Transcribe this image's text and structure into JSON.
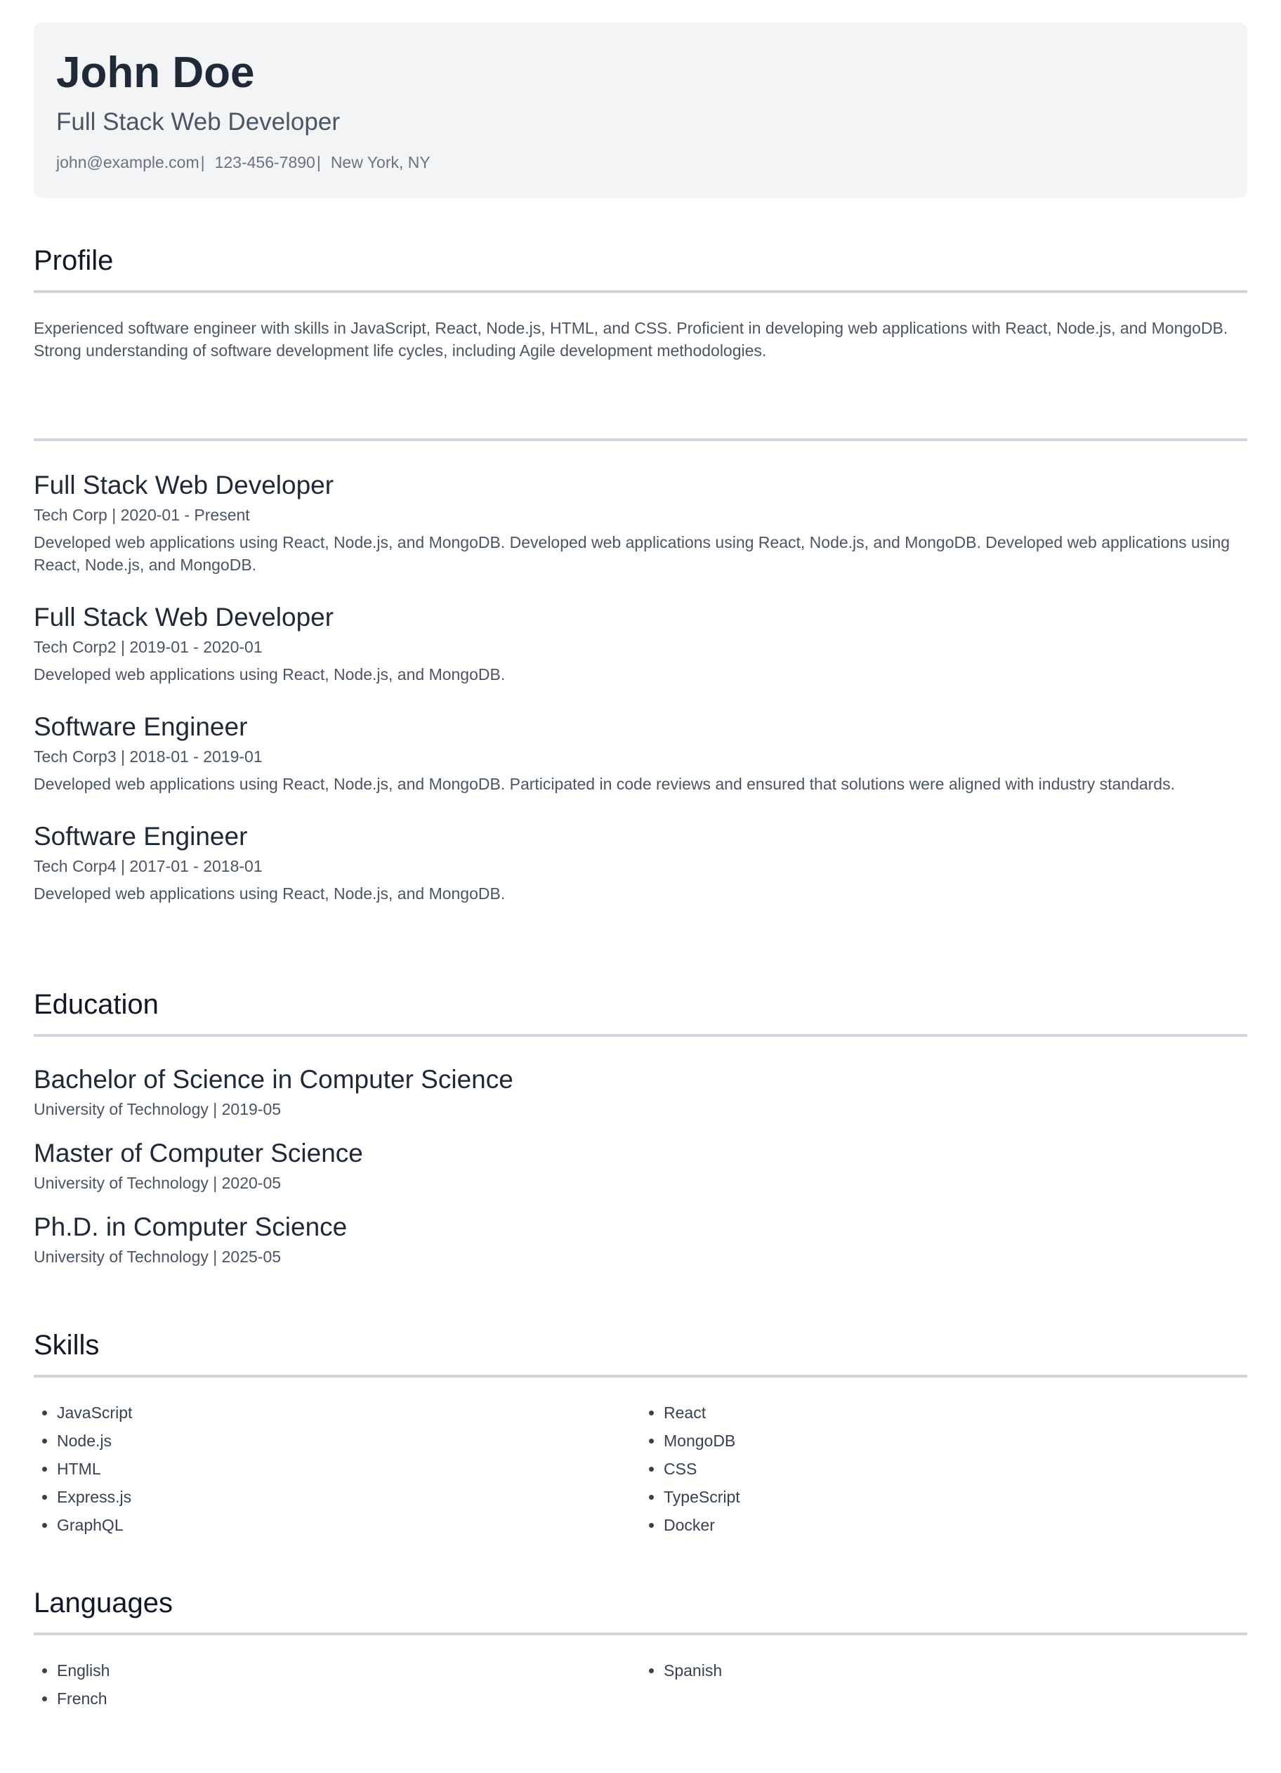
{
  "header": {
    "name": "John Doe",
    "headline": "Full Stack Web Developer",
    "email": "john@example.com",
    "phone": "123-456-7890",
    "location": "New York, NY",
    "separator": "|"
  },
  "profile": {
    "title": "Profile",
    "text": "Experienced software engineer with skills in JavaScript, React, Node.js, HTML, and CSS. Proficient in developing web applications with React, Node.js, and MongoDB. Strong understanding of software development life cycles, including Agile development methodologies."
  },
  "experience": {
    "items": [
      {
        "title": "Full Stack Web Developer",
        "meta": "Tech Corp | 2020-01 - Present",
        "description": "Developed web applications using React, Node.js, and MongoDB. Developed web applications using React, Node.js, and MongoDB. Developed web applications using React, Node.js, and MongoDB."
      },
      {
        "title": "Full Stack Web Developer",
        "meta": "Tech Corp2 | 2019-01 - 2020-01",
        "description": "Developed web applications using React, Node.js, and MongoDB."
      },
      {
        "title": "Software Engineer",
        "meta": "Tech Corp3 | 2018-01 - 2019-01",
        "description": "Developed web applications using React, Node.js, and MongoDB. Participated in code reviews and ensured that solutions were aligned with industry standards."
      },
      {
        "title": "Software Engineer",
        "meta": "Tech Corp4 | 2017-01 - 2018-01",
        "description": "Developed web applications using React, Node.js, and MongoDB."
      }
    ]
  },
  "education": {
    "title": "Education",
    "items": [
      {
        "degree": "Bachelor of Science in Computer Science",
        "meta": "University of Technology | 2019-05"
      },
      {
        "degree": "Master of Computer Science",
        "meta": "University of Technology | 2020-05"
      },
      {
        "degree": "Ph.D. in Computer Science",
        "meta": "University of Technology | 2025-05"
      }
    ]
  },
  "skills": {
    "title": "Skills",
    "left": [
      "JavaScript",
      "Node.js",
      "HTML",
      "Express.js",
      "GraphQL"
    ],
    "right": [
      "React",
      "MongoDB",
      "CSS",
      "TypeScript",
      "Docker"
    ]
  },
  "languages": {
    "title": "Languages",
    "left": [
      "English",
      "French"
    ],
    "right": [
      "Spanish"
    ]
  }
}
